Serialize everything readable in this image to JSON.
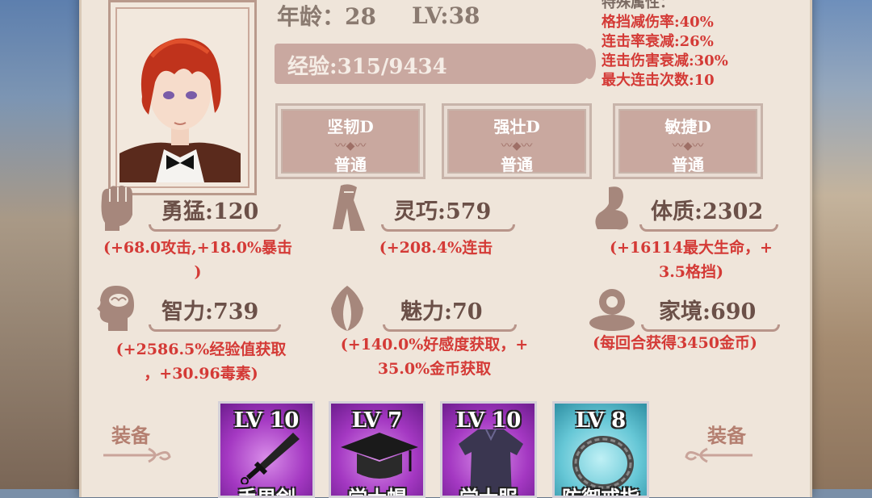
{
  "profile": {
    "age_text": "年龄：28",
    "level_text": "LV:38",
    "exp_text": "经验:315/9434"
  },
  "special": {
    "header": "特殊属性：",
    "lines": [
      "格挡减伤率:40%",
      "连击率衰减:26%",
      "连击伤害衰减:30%",
      "最大连击次数:10"
    ]
  },
  "traits": [
    {
      "name": "坚韧D",
      "rarity": "普通"
    },
    {
      "name": "强壮D",
      "rarity": "普通"
    },
    {
      "name": "敏捷D",
      "rarity": "普通"
    }
  ],
  "stats": [
    {
      "label": "勇猛:120",
      "desc1": "(+68.0攻击,+18.0%暴击",
      "desc2": ")",
      "icon": "fist-icon"
    },
    {
      "label": "灵巧:579",
      "desc1": "(+208.4%连击",
      "desc2": "",
      "icon": "cloth-icon"
    },
    {
      "label": "体质:2302",
      "desc1": "(+16114最大生命，+",
      "desc2": "3.5格挡)",
      "icon": "arm-icon"
    },
    {
      "label": "智力:739",
      "desc1": "(+2586.5%经验值获取",
      "desc2": "，+30.96毒素)",
      "icon": "brain-icon"
    },
    {
      "label": "魅力:70",
      "desc1": "(+140.0%好感度获取，+",
      "desc2": "35.0%金币获取",
      "icon": "flower-icon"
    },
    {
      "label": "家境:690",
      "desc1": "(每回合获得3450金币)",
      "desc2": "",
      "icon": "coin-icon"
    }
  ],
  "equipment": {
    "left_label": "装备",
    "right_label": "装备",
    "items": [
      {
        "level": "LV 10",
        "name": "手里剑",
        "rarity_color": "#a438c2",
        "icon": "kunai-icon"
      },
      {
        "level": "LV 7",
        "name": "学士帽",
        "rarity_color": "#a438c2",
        "icon": "mortarboard-icon"
      },
      {
        "level": "LV 10",
        "name": "学士服",
        "rarity_color": "#a438c2",
        "icon": "gown-icon"
      },
      {
        "level": "LV 8",
        "name": "防御戒指",
        "rarity_color": "#66c7d6",
        "icon": "ring-icon"
      }
    ]
  }
}
